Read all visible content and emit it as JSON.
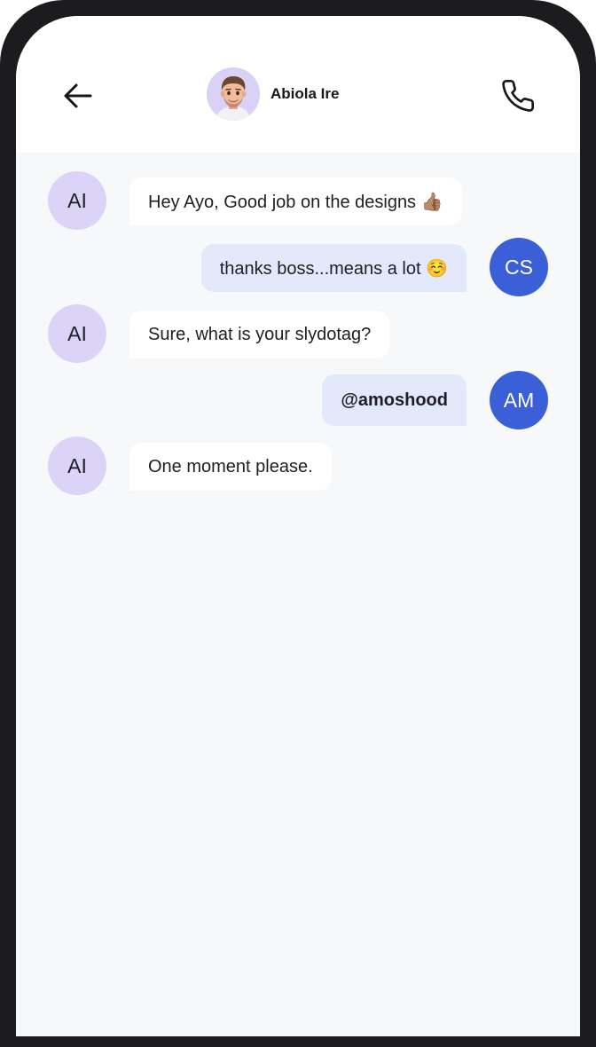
{
  "header": {
    "contact_name": "Abiola Ire",
    "back_icon": "arrow-left-icon",
    "call_icon": "phone-icon"
  },
  "colors": {
    "incoming_avatar_bg": "#dcd4f8",
    "outgoing_avatar_bg": "#3a5fd6",
    "incoming_bubble_bg": "#ffffff",
    "outgoing_bubble_bg": "#e4e8fb",
    "chat_background": "#f7f8fa"
  },
  "messages": [
    {
      "initials": "AI",
      "text": "Hey Ayo, Good job on the designs 👍🏽",
      "direction": "incoming"
    },
    {
      "initials": "CS",
      "text": "thanks boss...means a lot ☺️",
      "direction": "outgoing"
    },
    {
      "initials": "AI",
      "text": "Sure, what is your slydotag?",
      "direction": "incoming"
    },
    {
      "initials": "AM",
      "text": "@amoshood",
      "direction": "outgoing"
    },
    {
      "initials": "AI",
      "text": "One moment please.",
      "direction": "incoming"
    }
  ]
}
